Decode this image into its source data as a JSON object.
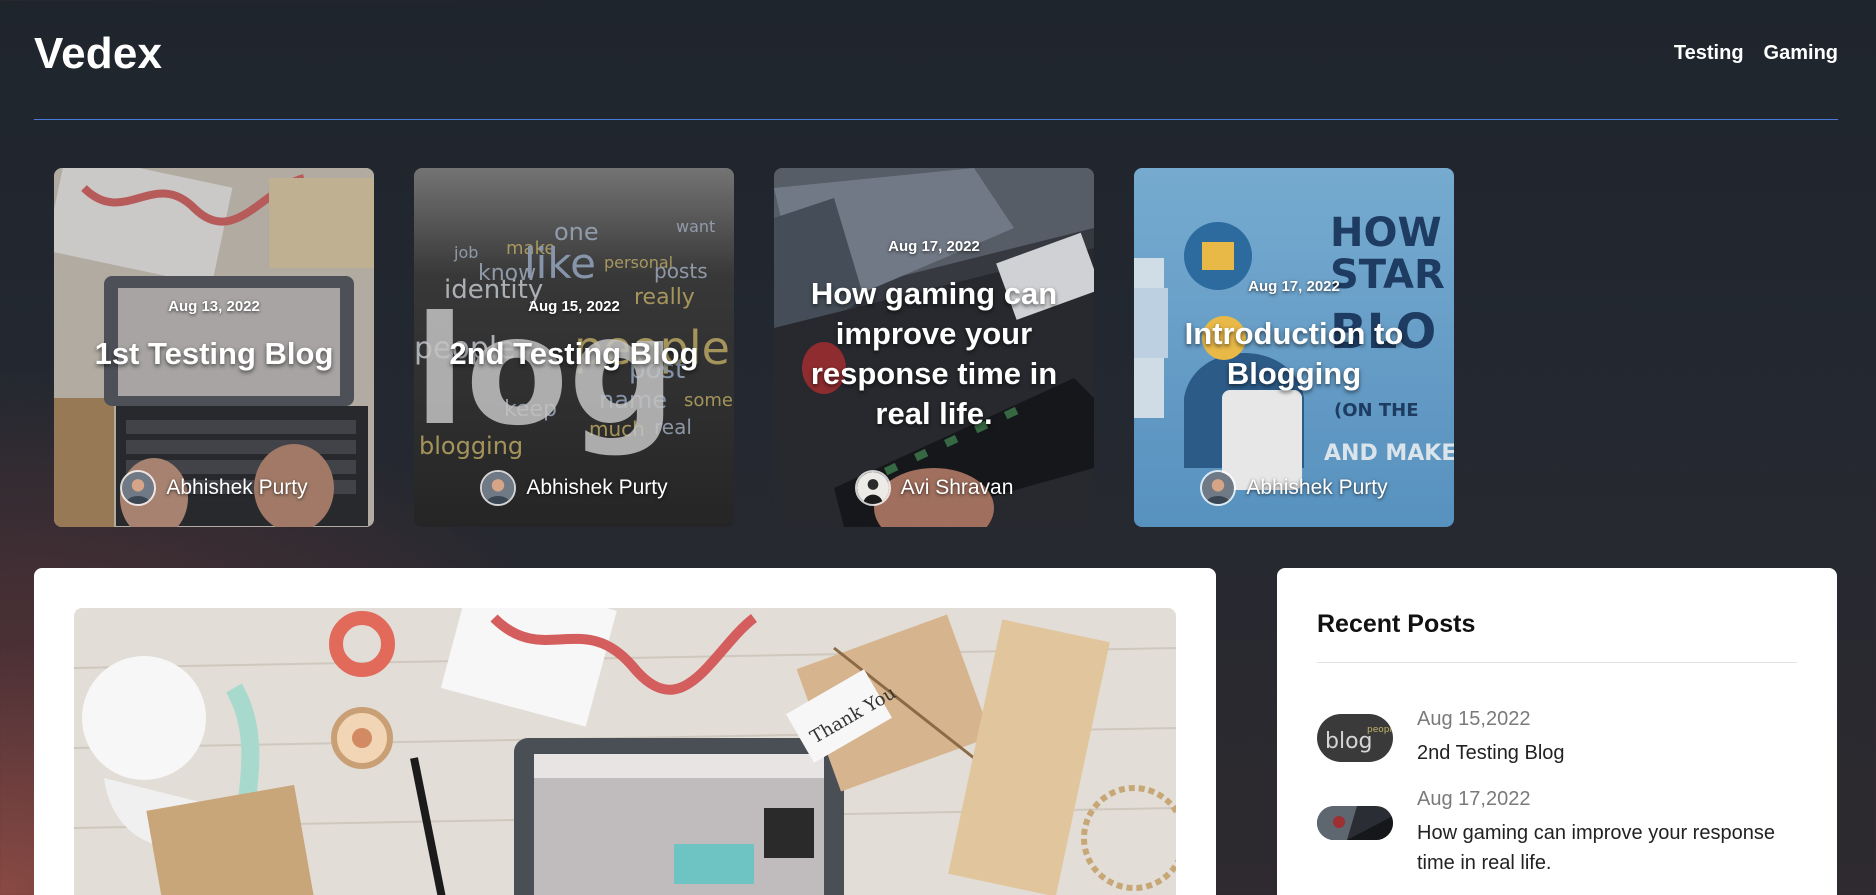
{
  "site": {
    "logo": "Vedex"
  },
  "nav": {
    "items": [
      {
        "label": "Testing"
      },
      {
        "label": "Gaming"
      }
    ]
  },
  "cards": [
    {
      "date": "Aug 13, 2022",
      "title": "1st Testing Blog",
      "author": "Abhishek Purty"
    },
    {
      "date": "Aug 15, 2022",
      "title": "2nd Testing Blog",
      "author": "Abhishek Purty"
    },
    {
      "date": "Aug 17, 2022",
      "title": "How gaming can improve your response time in real life.",
      "author": "Avi Shravan"
    },
    {
      "date": "Aug 17, 2022",
      "title": "Introduction to Blogging",
      "author": "Abhishek Purty"
    }
  ],
  "sidebar": {
    "title": "Recent Posts",
    "posts": [
      {
        "date": "Aug 15,2022",
        "title": "2nd Testing Blog"
      },
      {
        "date": "Aug 17,2022",
        "title": "How gaming can improve your response time in real life."
      }
    ]
  },
  "colors": {
    "accent_line": "#4a7ad8",
    "panel_bg": "#ffffff"
  }
}
